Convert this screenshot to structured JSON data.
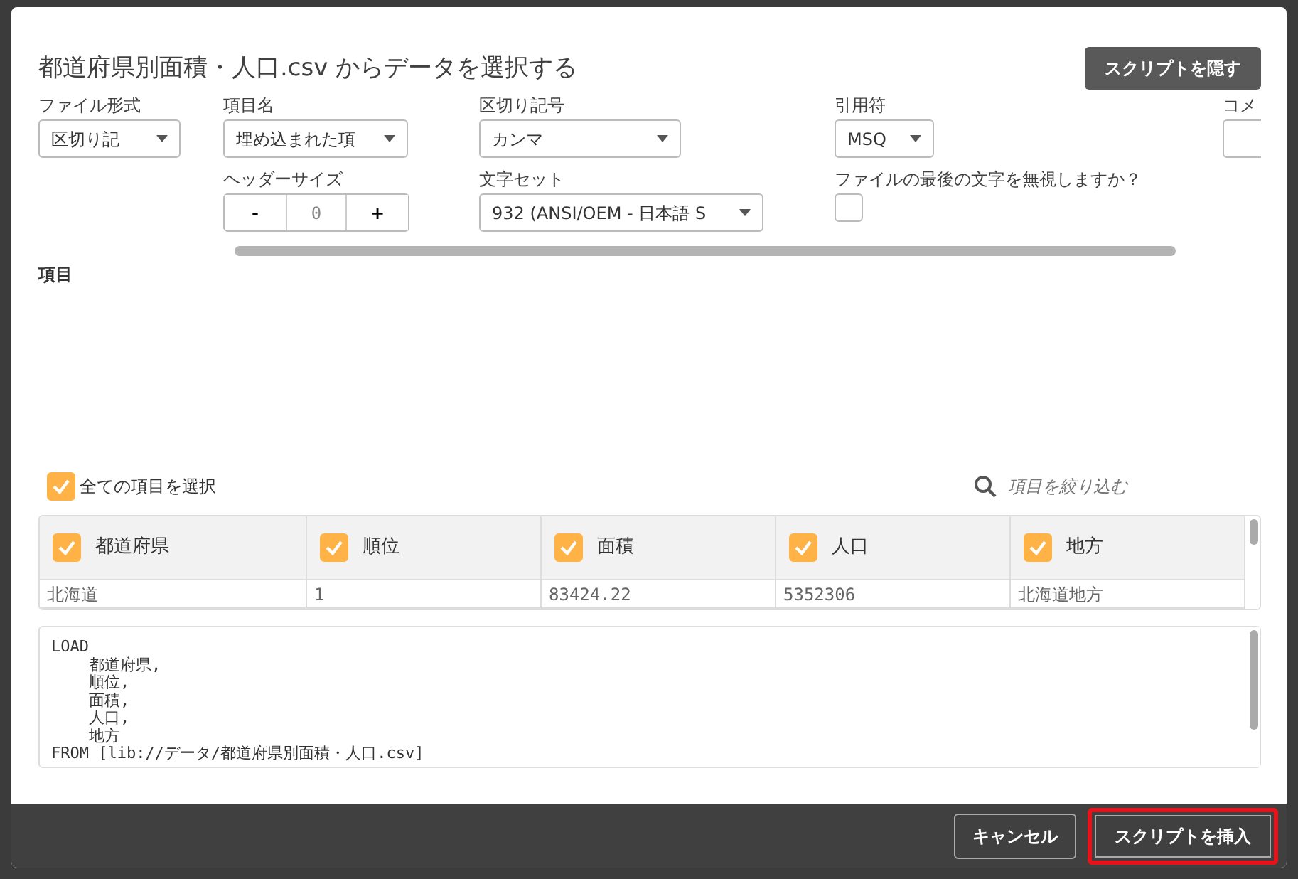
{
  "dialog": {
    "title": "都道府県別面積・人口.csv からデータを選択する",
    "hide_script_button": "スクリプトを隠す"
  },
  "options_row_1": [
    {
      "kind": "select",
      "label": "ファイル形式",
      "value": "区切り記"
    },
    {
      "kind": "select",
      "label": "項目名",
      "value": "埋め込まれた項"
    },
    {
      "kind": "select",
      "label": "区切り記号",
      "value": "カンマ"
    },
    {
      "kind": "select",
      "label": "引用符",
      "value": "MSQ"
    },
    {
      "kind": "input",
      "label": "コメ"
    }
  ],
  "options_row_2": [
    {
      "kind": "stepper",
      "label": "ヘッダーサイズ",
      "minus": "-",
      "value": "0",
      "plus": "+"
    },
    {
      "kind": "select",
      "label": "文字セット",
      "value": "932 (ANSI/OEM - 日本語 S"
    },
    {
      "kind": "checkbox",
      "label": "ファイルの最後の文字を無視しますか？",
      "checked": false
    }
  ],
  "fields_heading": "項目",
  "select_all": {
    "label": "全ての項目を選択",
    "checked": true
  },
  "filter": {
    "placeholder": "項目を絞り込む"
  },
  "table": {
    "columns": [
      {
        "label": "都道府県",
        "checked": true
      },
      {
        "label": "順位",
        "checked": true
      },
      {
        "label": "面積",
        "checked": true
      },
      {
        "label": "人口",
        "checked": true
      },
      {
        "label": "地方",
        "checked": true
      }
    ],
    "rows": [
      [
        "北海道",
        "1",
        "83424.22",
        "5352306",
        "北海道地方"
      ]
    ]
  },
  "script": "LOAD\n    都道府県,\n    順位,\n    面積,\n    人口,\n    地方\nFROM [lib://データ/都道府県別面積・人口.csv]",
  "footer": {
    "buttons": [
      {
        "label": "キャンセル",
        "highlighted": false
      },
      {
        "label": "スクリプトを挿入",
        "highlighted": true
      }
    ]
  }
}
